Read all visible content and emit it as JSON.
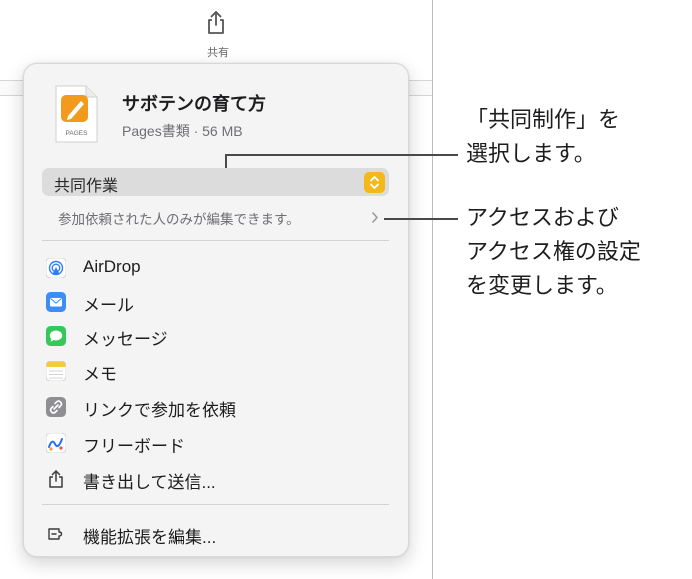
{
  "popover": {
    "file_title": "サボテンの育て方",
    "file_meta": "Pages書類 · 56 MB",
    "file_icon_label": "PAGES",
    "mode_select_value": "共同作業",
    "access_text": "参加依頼された人のみが編集できます。",
    "menu": [
      {
        "label": "AirDrop",
        "icon": "airdrop-icon"
      },
      {
        "label": "メール",
        "icon": "mail-icon"
      },
      {
        "label": "メッセージ",
        "icon": "messages-icon"
      },
      {
        "label": "メモ",
        "icon": "notes-icon"
      },
      {
        "label": "リンクで参加を依頼",
        "icon": "link-icon"
      },
      {
        "label": "フリーボード",
        "icon": "freeform-icon"
      },
      {
        "label": "書き出して送信...",
        "icon": "share-export-icon"
      }
    ],
    "extensions_label": "機能拡張を編集..."
  },
  "toolbar": {
    "share_label": "共有"
  },
  "callouts": {
    "select_collab_line1": "「共同制作」を",
    "select_collab_line2": "選択します。",
    "access_line1": "アクセスおよび",
    "access_line2": "アクセス権の設定",
    "access_line3": "を変更します。"
  },
  "colors": {
    "stepper": "#f3b81a",
    "pages_orange": "#f19a1c",
    "mail_blue": "#3d8df5",
    "messages_green": "#34c759"
  }
}
